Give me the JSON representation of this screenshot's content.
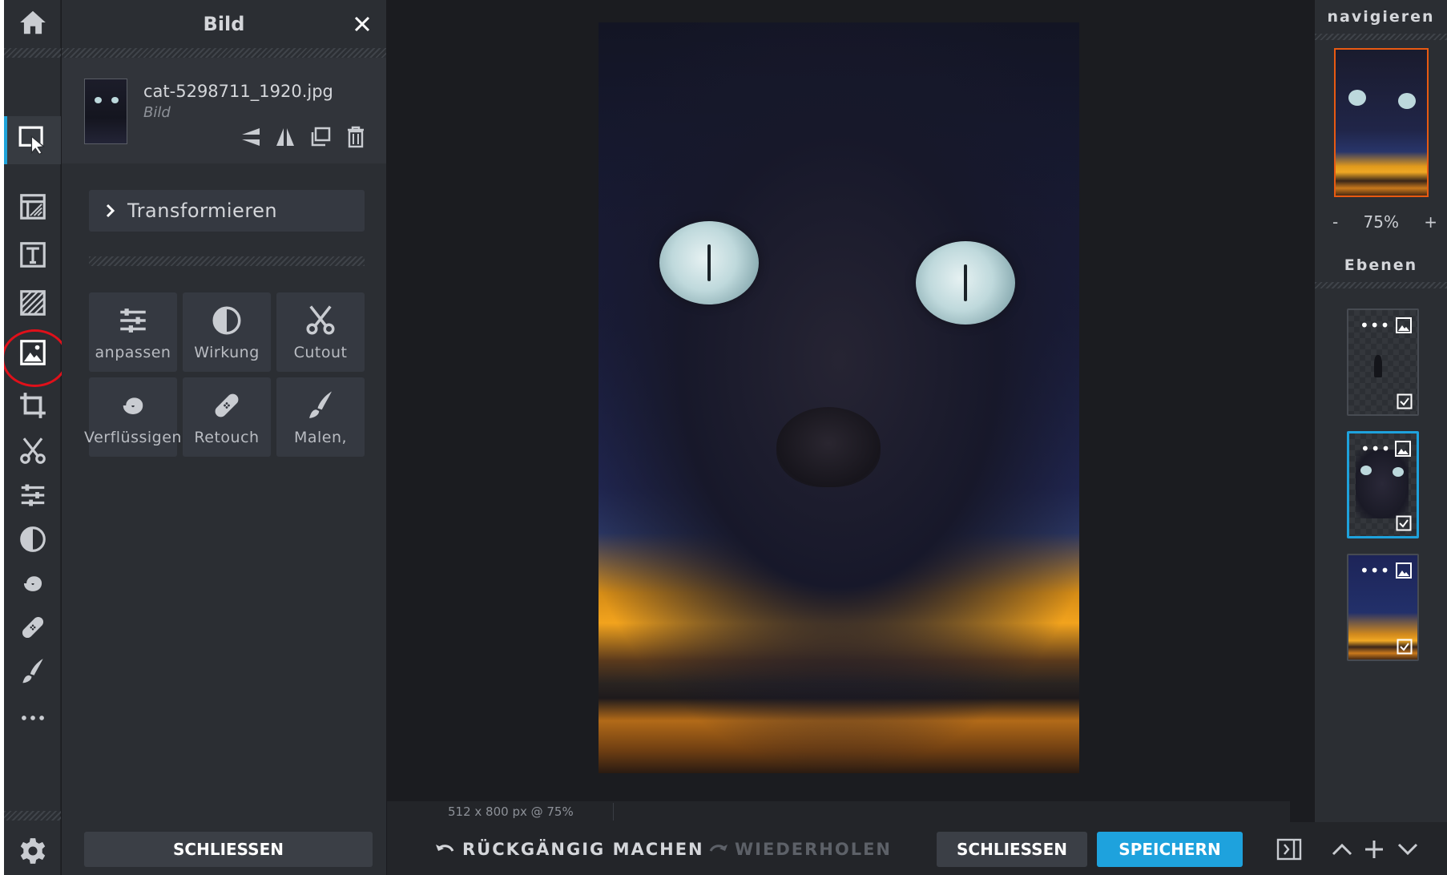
{
  "panel": {
    "title": "Bild",
    "file_name": "cat-5298711_1920.jpg",
    "file_type": "Bild",
    "transform_label": "Transformieren",
    "tools": [
      {
        "label": "anpassen",
        "icon": "sliders-icon"
      },
      {
        "label": "Wirkung",
        "icon": "contrast-icon"
      },
      {
        "label": "Cutout",
        "icon": "scissors-icon"
      },
      {
        "label": "Verflüssigen",
        "icon": "swirl-icon"
      },
      {
        "label": "Retouch",
        "icon": "bandage-icon"
      },
      {
        "label": "Malen,",
        "icon": "brush-icon"
      }
    ],
    "close_label": "SCHLIESSEN"
  },
  "toolbar": {
    "icons": [
      "home-icon",
      "arrange-icon",
      "layers-style-icon",
      "text-icon",
      "pattern-icon",
      "image-icon",
      "crop-icon",
      "cutout-icon",
      "adjust-icon",
      "effect-icon",
      "liquify-icon",
      "retouch-icon",
      "draw-icon",
      "more-icon",
      "settings-icon"
    ]
  },
  "canvas": {
    "status": "512 x 800 px @ 75%"
  },
  "bottombar": {
    "undo_label": "RÜCKGÄNGIG MACHEN",
    "redo_label": "WIEDERHOLEN",
    "close_label": "SCHLIESSEN",
    "save_label": "SPEICHERN"
  },
  "rightpanel": {
    "navigate_heading": "navigieren",
    "zoom_minus": "-",
    "zoom_value": "75%",
    "zoom_plus": "+",
    "layers_heading": "Ebenen"
  },
  "colors": {
    "accent": "#1ea2dd",
    "highlight": "#e0101a",
    "nav_frame": "#e85a12"
  }
}
